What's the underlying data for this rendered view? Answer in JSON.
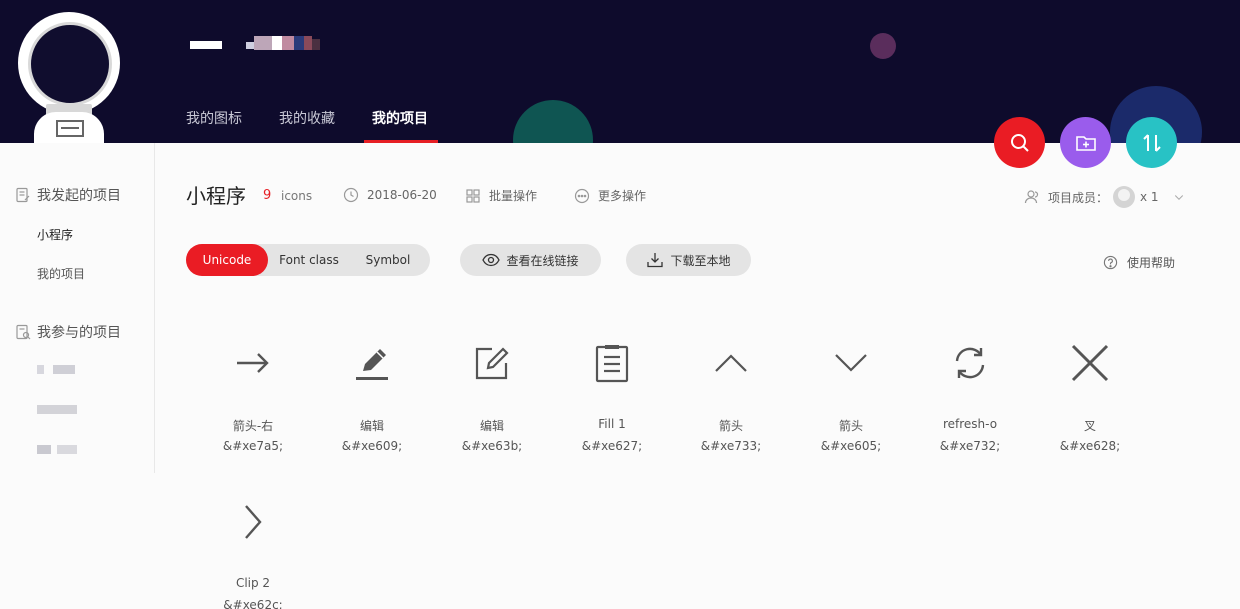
{
  "header": {
    "nav": [
      {
        "label": "我的图标",
        "active": false
      },
      {
        "label": "我的收藏",
        "active": false
      },
      {
        "label": "我的项目",
        "active": true
      }
    ],
    "actions": [
      {
        "name": "search",
        "icon": "search-icon",
        "color": "#ea1c24"
      },
      {
        "name": "new-project",
        "icon": "folder-plus-icon",
        "color": "#9a5cec"
      },
      {
        "name": "import",
        "icon": "sort-arrows-icon",
        "color": "#28c2c5"
      }
    ]
  },
  "sidebar": {
    "sections": [
      {
        "title": "我发起的项目",
        "items": [
          "小程序",
          "我的项目"
        ]
      },
      {
        "title": "我参与的项目",
        "items": []
      }
    ]
  },
  "project": {
    "title": "小程序",
    "count": "9",
    "count_label": "icons",
    "date": "2018-06-20",
    "batch_label": "批量操作",
    "more_label": "更多操作",
    "members_label": "项目成员：",
    "members_count": "x 1"
  },
  "toolbar": {
    "tabs": [
      {
        "label": "Unicode",
        "active": true
      },
      {
        "label": "Font class",
        "active": false
      },
      {
        "label": "Symbol",
        "active": false
      }
    ],
    "view_link_label": "查看在线链接",
    "download_label": "下载至本地",
    "help_label": "使用帮助"
  },
  "icons": [
    {
      "name": "箭头-右",
      "code": "&#xe7a5;",
      "glyph": "arrow-right-icon"
    },
    {
      "name": "编辑",
      "code": "&#xe609;",
      "glyph": "pencil-icon"
    },
    {
      "name": "编辑",
      "code": "&#xe63b;",
      "glyph": "edit-square-icon"
    },
    {
      "name": "Fill 1",
      "code": "&#xe627;",
      "glyph": "clipboard-icon"
    },
    {
      "name": "箭头",
      "code": "&#xe733;",
      "glyph": "chevron-up-icon"
    },
    {
      "name": "箭头",
      "code": "&#xe605;",
      "glyph": "chevron-down-icon"
    },
    {
      "name": "refresh-o",
      "code": "&#xe732;",
      "glyph": "refresh-icon"
    },
    {
      "name": "叉",
      "code": "&#xe628;",
      "glyph": "close-icon"
    },
    {
      "name": "Clip 2",
      "code": "&#xe62c;",
      "glyph": "chevron-right-icon"
    }
  ]
}
